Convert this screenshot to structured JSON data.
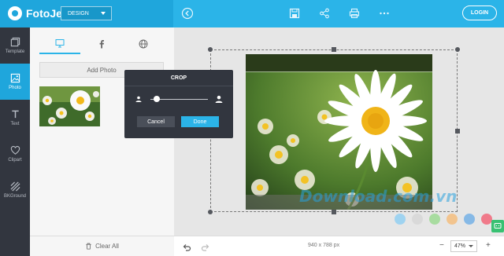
{
  "app": {
    "name": "FotoJet",
    "mode": "DESIGN",
    "login": "LOGIN"
  },
  "toolbar": {
    "icons": [
      "back-icon",
      "save-icon",
      "share-icon",
      "print-icon",
      "more-icon"
    ]
  },
  "rail": {
    "items": [
      {
        "label": "Template",
        "icon": "template-icon"
      },
      {
        "label": "Photo",
        "icon": "photo-icon",
        "active": true
      },
      {
        "label": "Text",
        "icon": "text-icon"
      },
      {
        "label": "Clipart",
        "icon": "heart-icon"
      },
      {
        "label": "BKGround",
        "icon": "background-icon"
      }
    ]
  },
  "panel": {
    "tabs": [
      "computer-icon",
      "facebook-icon",
      "web-icon"
    ],
    "add_photo": "Add Photo",
    "clear_all": "Clear All"
  },
  "crop": {
    "title": "CROP",
    "cancel": "Cancel",
    "done": "Done",
    "level": 0.05
  },
  "canvas": {
    "dimensions": "940 x 788 px",
    "watermark": "Download.com.vn",
    "palette": [
      "#9fd3f0",
      "#d9d9d9",
      "#a8dca0",
      "#f2c48e",
      "#86b9e6",
      "#f07a8a"
    ]
  },
  "zoom": {
    "value": "47%"
  },
  "colors": {
    "accent": "#2bb4e8",
    "rail": "#32363f"
  }
}
